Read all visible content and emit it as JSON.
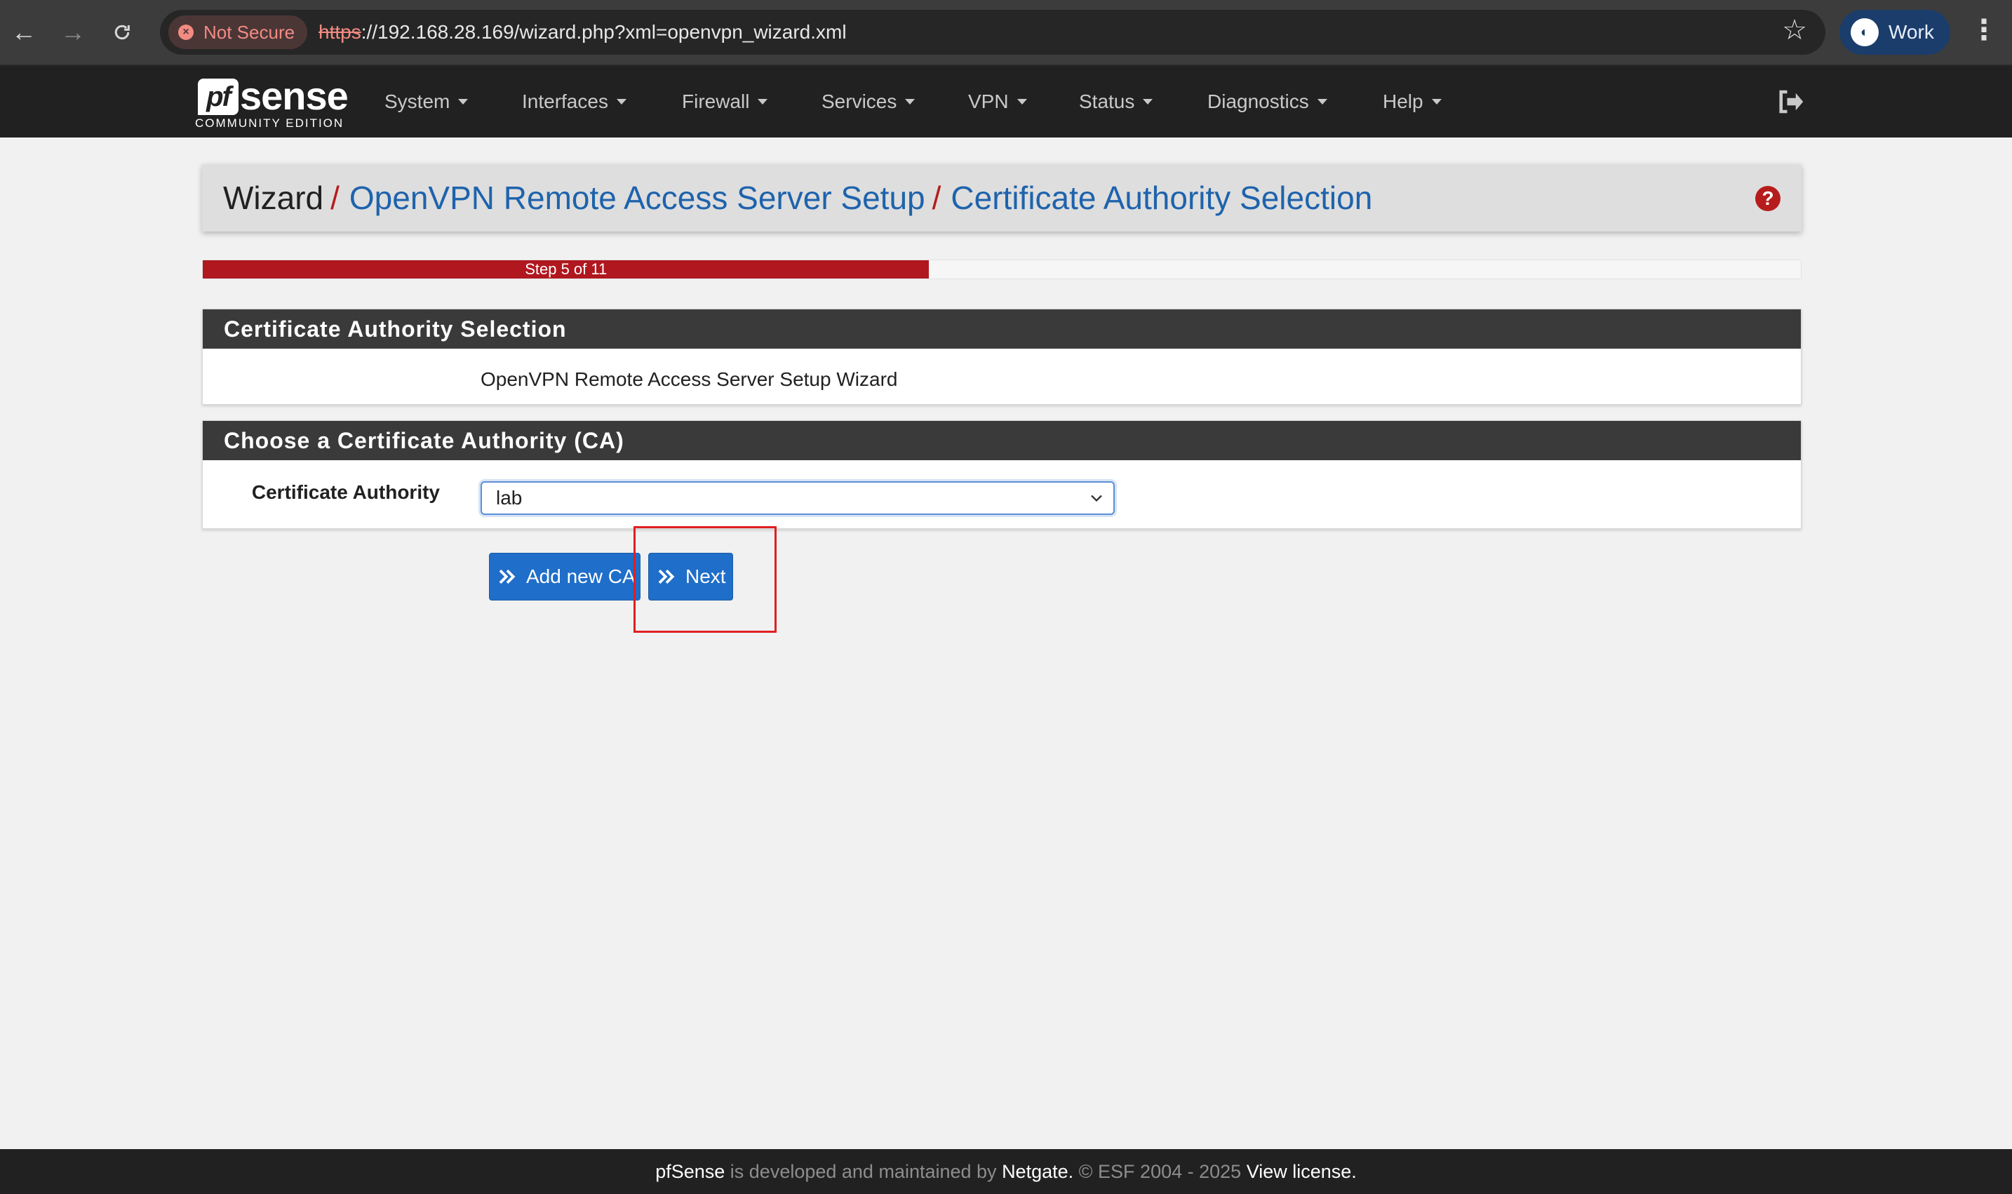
{
  "browser": {
    "not_secure": "Not Secure",
    "url_scheme": "https",
    "url_rest": "://192.168.28.169/wizard.php?xml=openvpn_wizard.xml",
    "profile": "Work"
  },
  "brand": {
    "name": "sense",
    "mark": "pf",
    "edition": "COMMUNITY EDITION"
  },
  "nav": {
    "items": [
      "System",
      "Interfaces",
      "Firewall",
      "Services",
      "VPN",
      "Status",
      "Diagnostics",
      "Help"
    ]
  },
  "breadcrumb": {
    "root": "Wizard",
    "sep": "/",
    "level1": "OpenVPN Remote Access Server Setup",
    "level2": "Certificate Authority Selection"
  },
  "progress": {
    "label": "Step 5 of 11",
    "step": 5,
    "total": 11
  },
  "panels": {
    "ca_selection": {
      "title": "Certificate Authority Selection",
      "description": "OpenVPN Remote Access Server Setup Wizard"
    },
    "choose_ca": {
      "title": "Choose a Certificate Authority (CA)",
      "field_label": "Certificate Authority",
      "selected": "lab"
    }
  },
  "buttons": {
    "add_ca": "Add new CA",
    "next": "Next"
  },
  "footer": {
    "brand": "pfSense",
    "text1": " is developed and maintained by ",
    "company": "Netgate.",
    "text2": " © ESF 2004 - 2025 ",
    "license": "View license."
  },
  "colors": {
    "accent_red": "#b0171f",
    "link_blue": "#1e63ac",
    "button_blue": "#1f6ec9",
    "nav_bg": "#212121",
    "annotation_red": "#e02020"
  }
}
